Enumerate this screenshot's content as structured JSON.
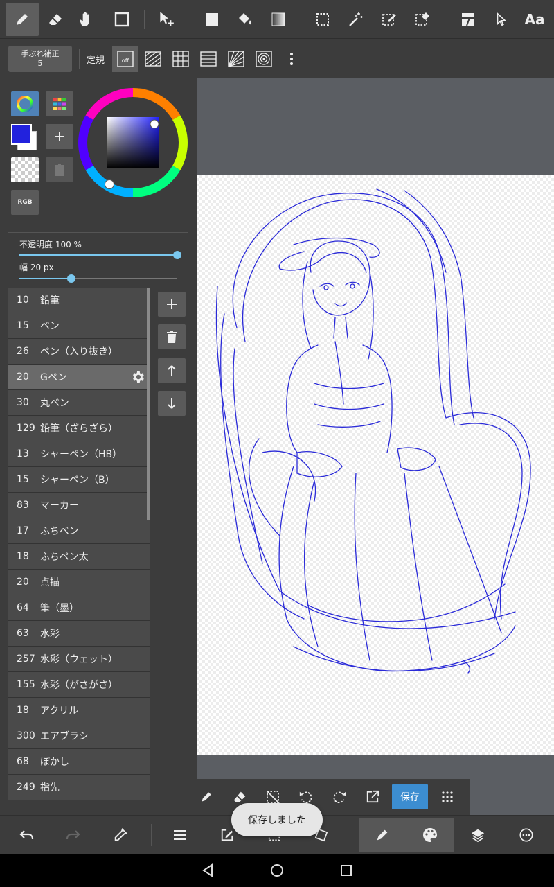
{
  "top_toolbar": {
    "tools": [
      "pen-icon",
      "eraser-icon",
      "hand-icon",
      "shape-icon",
      "move-icon",
      "fill-rect-icon",
      "bucket-icon",
      "gradient-icon",
      "select-rect-icon",
      "magic-wand-icon",
      "select-pen-icon",
      "select-eraser-icon",
      "frame-icon",
      "pointer-icon",
      "text-icon"
    ],
    "text_tool_label": "Aa"
  },
  "sub_toolbar": {
    "stabilizer_label": "手ぶれ補正",
    "stabilizer_value": "5",
    "ruler_label": "定規",
    "ruler_off_label": "off"
  },
  "color_panel": {
    "main_color": "#2222dd",
    "rgb_label": "RGB",
    "opacity_label": "不透明度 100 %",
    "opacity_value": 100,
    "width_label": "幅 20 px",
    "width_value": 20
  },
  "brushes": [
    {
      "size": "10",
      "name": "鉛筆"
    },
    {
      "size": "15",
      "name": "ペン"
    },
    {
      "size": "26",
      "name": "ペン（入り抜き）"
    },
    {
      "size": "20",
      "name": "Gペン",
      "selected": true
    },
    {
      "size": "30",
      "name": "丸ペン"
    },
    {
      "size": "129",
      "name": "鉛筆（ざらざら）"
    },
    {
      "size": "13",
      "name": "シャーペン（HB）"
    },
    {
      "size": "15",
      "name": "シャーペン（B）"
    },
    {
      "size": "83",
      "name": "マーカー"
    },
    {
      "size": "17",
      "name": "ふちペン"
    },
    {
      "size": "18",
      "name": "ふちペン太"
    },
    {
      "size": "20",
      "name": "点描"
    },
    {
      "size": "64",
      "name": "筆（墨）"
    },
    {
      "size": "63",
      "name": "水彩"
    },
    {
      "size": "257",
      "name": "水彩（ウェット）"
    },
    {
      "size": "155",
      "name": "水彩（がさがさ）"
    },
    {
      "size": "18",
      "name": "アクリル"
    },
    {
      "size": "300",
      "name": "エアブラシ"
    },
    {
      "size": "68",
      "name": "ぼかし"
    },
    {
      "size": "249",
      "name": "指先"
    }
  ],
  "canvas_toolbar": {
    "save_label": "保存"
  },
  "toast": {
    "message": "保存しました"
  },
  "colors": {
    "accent": "#3c8dd0",
    "slider": "#7ac7ee",
    "stroke": "#2a2ad8"
  }
}
